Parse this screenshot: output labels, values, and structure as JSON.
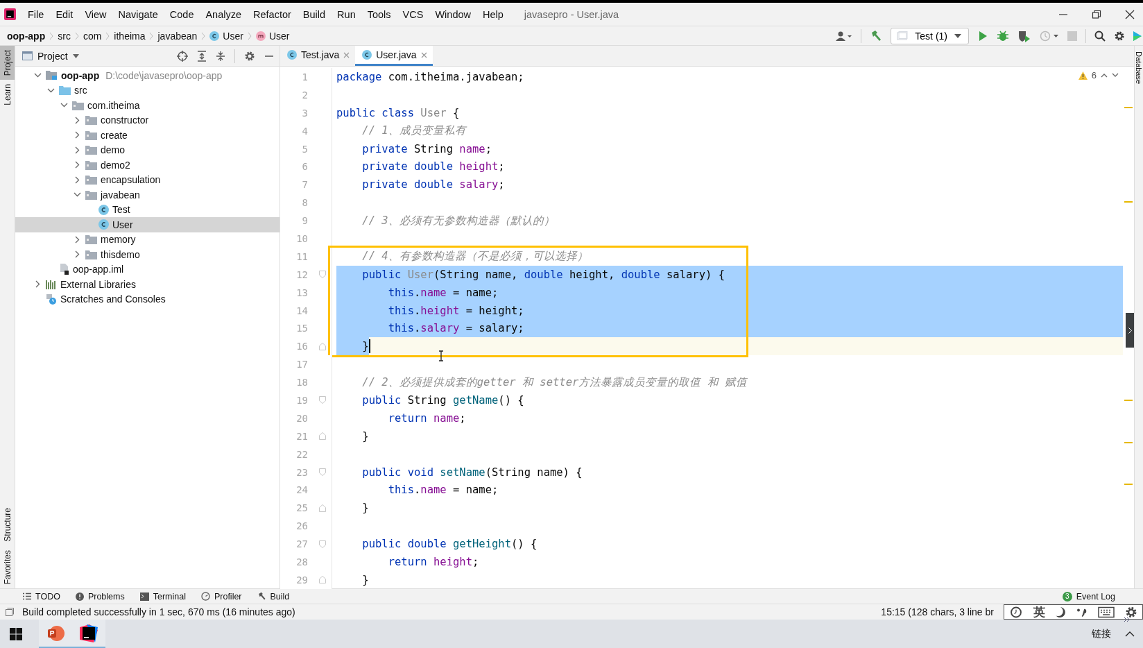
{
  "window": {
    "title": "javasepro - User.java"
  },
  "menu": [
    "File",
    "Edit",
    "View",
    "Navigate",
    "Code",
    "Analyze",
    "Refactor",
    "Build",
    "Run",
    "Tools",
    "VCS",
    "Window",
    "Help"
  ],
  "breadcrumb": [
    {
      "label": "oop-app",
      "kind": "module"
    },
    {
      "label": "src",
      "kind": "folder"
    },
    {
      "label": "com",
      "kind": "folder"
    },
    {
      "label": "itheima",
      "kind": "folder"
    },
    {
      "label": "javabean",
      "kind": "folder"
    },
    {
      "label": "User",
      "kind": "class"
    },
    {
      "label": "User",
      "kind": "method"
    }
  ],
  "run_config": {
    "label": "Test (1)"
  },
  "left_strip": [
    {
      "label": "Project",
      "selected": true
    },
    {
      "label": "Learn",
      "selected": false
    },
    {
      "label": "Structure",
      "selected": false
    },
    {
      "label": "Favorites",
      "selected": false
    }
  ],
  "right_strip": [
    {
      "label": "Database"
    }
  ],
  "project": {
    "title": "Project",
    "tree": [
      {
        "label": "oop-app",
        "path": "D:\\code\\javasepro\\oop-app",
        "kind": "module",
        "expanded": true,
        "selected": false,
        "children": [
          {
            "label": "src",
            "kind": "source",
            "expanded": true,
            "selected": false,
            "children": [
              {
                "label": "com.itheima",
                "kind": "package",
                "expanded": true,
                "selected": false,
                "children": [
                  {
                    "label": "constructor",
                    "kind": "package",
                    "expanded": false,
                    "selected": false
                  },
                  {
                    "label": "create",
                    "kind": "package",
                    "expanded": false,
                    "selected": false
                  },
                  {
                    "label": "demo",
                    "kind": "package",
                    "expanded": false,
                    "selected": false
                  },
                  {
                    "label": "demo2",
                    "kind": "package",
                    "expanded": false,
                    "selected": false
                  },
                  {
                    "label": "encapsulation",
                    "kind": "package",
                    "expanded": false,
                    "selected": false
                  },
                  {
                    "label": "javabean",
                    "kind": "package",
                    "expanded": true,
                    "selected": false,
                    "children": [
                      {
                        "label": "Test",
                        "kind": "class",
                        "selected": false
                      },
                      {
                        "label": "User",
                        "kind": "class",
                        "selected": true
                      }
                    ]
                  },
                  {
                    "label": "memory",
                    "kind": "package",
                    "expanded": false,
                    "selected": false
                  },
                  {
                    "label": "thisdemo",
                    "kind": "package",
                    "expanded": false,
                    "selected": false
                  }
                ]
              }
            ]
          },
          {
            "label": "oop-app.iml",
            "kind": "file",
            "selected": false
          }
        ]
      },
      {
        "label": "External Libraries",
        "kind": "libraries",
        "expanded": false,
        "selected": false
      },
      {
        "label": "Scratches and Consoles",
        "kind": "scratches",
        "selected": false
      }
    ]
  },
  "tabs": [
    {
      "label": "Test.java",
      "selected": false
    },
    {
      "label": "User.java",
      "selected": true
    }
  ],
  "inspections": {
    "warnings": "6"
  },
  "lines": [
    {
      "number": "1",
      "kind": "code",
      "selected": false,
      "caret": false,
      "boxed": false,
      "tokens": [
        {
          "kind": "kw",
          "text": "package"
        },
        {
          "kind": "plain",
          "text": " com.itheima.javabean;"
        }
      ]
    },
    {
      "number": "2",
      "kind": "code",
      "selected": false,
      "caret": false,
      "boxed": false
    },
    {
      "number": "3",
      "kind": "code",
      "selected": false,
      "caret": false,
      "boxed": false,
      "tokens": [
        {
          "kind": "kw",
          "text": "public class "
        },
        {
          "kind": "unused",
          "text": "User"
        },
        {
          "kind": "plain",
          "text": " {"
        }
      ]
    },
    {
      "number": "4",
      "kind": "code",
      "selected": false,
      "caret": false,
      "boxed": false,
      "tokens": [
        {
          "kind": "comment",
          "text": "    // 1、成员变量私有"
        }
      ]
    },
    {
      "number": "5",
      "kind": "code",
      "selected": false,
      "caret": false,
      "boxed": false,
      "tokens": [
        {
          "kind": "kw",
          "text": "    private"
        },
        {
          "kind": "plain",
          "text": " String "
        },
        {
          "kind": "field",
          "text": "name"
        },
        {
          "kind": "plain",
          "text": ";"
        }
      ]
    },
    {
      "number": "6",
      "kind": "code",
      "selected": false,
      "caret": false,
      "boxed": false,
      "tokens": [
        {
          "kind": "kw",
          "text": "    private double "
        },
        {
          "kind": "field",
          "text": "height"
        },
        {
          "kind": "plain",
          "text": ";"
        }
      ]
    },
    {
      "number": "7",
      "kind": "code",
      "selected": false,
      "caret": false,
      "boxed": false,
      "tokens": [
        {
          "kind": "kw",
          "text": "    private double "
        },
        {
          "kind": "field",
          "text": "salary"
        },
        {
          "kind": "plain",
          "text": ";"
        }
      ]
    },
    {
      "number": "8",
      "kind": "code",
      "selected": false,
      "caret": false,
      "boxed": false
    },
    {
      "number": "9",
      "kind": "code",
      "selected": false,
      "caret": false,
      "boxed": false,
      "tokens": [
        {
          "kind": "comment",
          "text": "    // 3、必须有无参数构造器（默认的）"
        }
      ]
    },
    {
      "number": "10",
      "kind": "code",
      "selected": false,
      "caret": false,
      "boxed": false
    },
    {
      "number": "11",
      "kind": "code",
      "selected": false,
      "caret": false,
      "boxed": true,
      "tokens": [
        {
          "kind": "comment",
          "text": "    // 4、有参数构造器（不是必须，可以选择）"
        }
      ]
    },
    {
      "number": "12",
      "kind": "fold-start",
      "selected": true,
      "caret": false,
      "boxed": true,
      "tokens": [
        {
          "kind": "kw",
          "text": "    public "
        },
        {
          "kind": "unused",
          "text": "User"
        },
        {
          "kind": "plain",
          "text": "(String name, "
        },
        {
          "kind": "kw",
          "text": "double"
        },
        {
          "kind": "plain",
          "text": " height, "
        },
        {
          "kind": "kw",
          "text": "double"
        },
        {
          "kind": "plain",
          "text": " salary) {"
        }
      ]
    },
    {
      "number": "13",
      "kind": "code",
      "selected": true,
      "caret": false,
      "boxed": true,
      "tokens": [
        {
          "kind": "kw",
          "text": "        this"
        },
        {
          "kind": "plain",
          "text": "."
        },
        {
          "kind": "field",
          "text": "name"
        },
        {
          "kind": "plain",
          "text": " = name;"
        }
      ]
    },
    {
      "number": "14",
      "kind": "code",
      "selected": true,
      "caret": false,
      "boxed": true,
      "tokens": [
        {
          "kind": "kw",
          "text": "        this"
        },
        {
          "kind": "plain",
          "text": "."
        },
        {
          "kind": "field",
          "text": "height"
        },
        {
          "kind": "plain",
          "text": " = height;"
        }
      ]
    },
    {
      "number": "15",
      "kind": "code",
      "selected": true,
      "caret": false,
      "boxed": true,
      "tokens": [
        {
          "kind": "kw",
          "text": "        this"
        },
        {
          "kind": "plain",
          "text": "."
        },
        {
          "kind": "field",
          "text": "salary"
        },
        {
          "kind": "plain",
          "text": " = salary;"
        }
      ]
    },
    {
      "number": "16",
      "kind": "fold-end",
      "selected": true,
      "caret": true,
      "boxed": true,
      "tokens": [
        {
          "kind": "plain",
          "text": "    }"
        }
      ]
    },
    {
      "number": "17",
      "kind": "code",
      "selected": false,
      "caret": false,
      "boxed": false
    },
    {
      "number": "18",
      "kind": "code",
      "selected": false,
      "caret": false,
      "boxed": false,
      "tokens": [
        {
          "kind": "comment",
          "text": "    // 2、必须提供成套的getter 和 setter方法暴露成员变量的取值 和 赋值"
        }
      ]
    },
    {
      "number": "19",
      "kind": "fold-start",
      "selected": false,
      "caret": false,
      "boxed": false,
      "tokens": [
        {
          "kind": "kw",
          "text": "    public"
        },
        {
          "kind": "plain",
          "text": " String "
        },
        {
          "kind": "method",
          "text": "getName"
        },
        {
          "kind": "plain",
          "text": "() {"
        }
      ]
    },
    {
      "number": "20",
      "kind": "code",
      "selected": false,
      "caret": false,
      "boxed": false,
      "tokens": [
        {
          "kind": "kw",
          "text": "        return "
        },
        {
          "kind": "field",
          "text": "name"
        },
        {
          "kind": "plain",
          "text": ";"
        }
      ]
    },
    {
      "number": "21",
      "kind": "fold-end",
      "selected": false,
      "caret": false,
      "boxed": false,
      "tokens": [
        {
          "kind": "plain",
          "text": "    }"
        }
      ]
    },
    {
      "number": "22",
      "kind": "code",
      "selected": false,
      "caret": false,
      "boxed": false
    },
    {
      "number": "23",
      "kind": "fold-start",
      "selected": false,
      "caret": false,
      "boxed": false,
      "tokens": [
        {
          "kind": "kw",
          "text": "    public void "
        },
        {
          "kind": "method",
          "text": "setName"
        },
        {
          "kind": "plain",
          "text": "(String name) {"
        }
      ]
    },
    {
      "number": "24",
      "kind": "code",
      "selected": false,
      "caret": false,
      "boxed": false,
      "tokens": [
        {
          "kind": "kw",
          "text": "        this"
        },
        {
          "kind": "plain",
          "text": "."
        },
        {
          "kind": "field",
          "text": "name"
        },
        {
          "kind": "plain",
          "text": " = name;"
        }
      ]
    },
    {
      "number": "25",
      "kind": "fold-end",
      "selected": false,
      "caret": false,
      "boxed": false,
      "tokens": [
        {
          "kind": "plain",
          "text": "    }"
        }
      ]
    },
    {
      "number": "26",
      "kind": "code",
      "selected": false,
      "caret": false,
      "boxed": false
    },
    {
      "number": "27",
      "kind": "fold-start",
      "selected": false,
      "caret": false,
      "boxed": false,
      "tokens": [
        {
          "kind": "kw",
          "text": "    public double "
        },
        {
          "kind": "method",
          "text": "getHeight"
        },
        {
          "kind": "plain",
          "text": "() {"
        }
      ]
    },
    {
      "number": "28",
      "kind": "code",
      "selected": false,
      "caret": false,
      "boxed": false,
      "tokens": [
        {
          "kind": "kw",
          "text": "        return "
        },
        {
          "kind": "field",
          "text": "height"
        },
        {
          "kind": "plain",
          "text": ";"
        }
      ]
    },
    {
      "number": "29",
      "kind": "fold-end",
      "selected": false,
      "caret": false,
      "boxed": false,
      "tokens": [
        {
          "kind": "plain",
          "text": "    }"
        }
      ]
    }
  ],
  "tool_windows": [
    {
      "label": "TODO",
      "kind": "list"
    },
    {
      "label": "Problems",
      "kind": "problems"
    },
    {
      "label": "Terminal",
      "kind": "terminal"
    },
    {
      "label": "Profiler",
      "kind": "profiler"
    },
    {
      "label": "Build",
      "kind": "build"
    }
  ],
  "event_log": {
    "label": "Event Log",
    "count": "3"
  },
  "status_bar": {
    "message": "Build completed successfully in 1 sec, 670 ms (16 minutes ago)",
    "position": "15:15 (128 chars, 3 line br"
  },
  "ime": {
    "mode": "英"
  },
  "taskbar": {
    "apps": [
      {
        "kind": "powerpoint",
        "active": true
      },
      {
        "kind": "intellij",
        "active": true
      }
    ],
    "tray_label": "链接"
  }
}
